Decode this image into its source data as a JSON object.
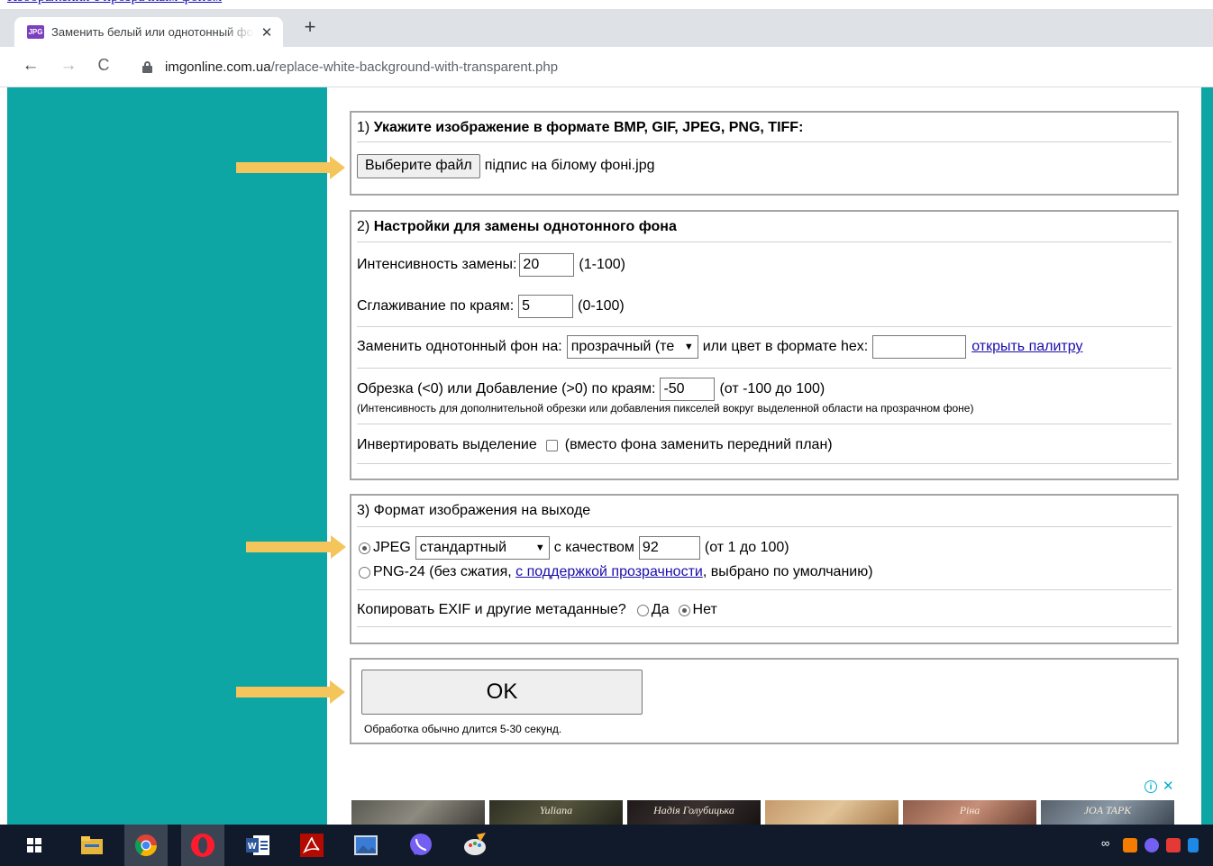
{
  "browser": {
    "tab_title": "Заменить белый или однотонный фон на прозрачный онлайн",
    "favicon_text": "JPG",
    "url_host": "imgonline.com.ua",
    "url_path": "/replace-white-background-with-transparent.php"
  },
  "section1": {
    "num": "1)",
    "title": "Укажите изображение в формате BMP, GIF, JPEG, PNG, TIFF:",
    "choose_file_label": "Выберите файл",
    "file_name": "підпис на білому фоні.jpg"
  },
  "section2": {
    "num": "2)",
    "title": "Настройки для замены однотонного фона",
    "intensity_label": "Интенсивность замены:",
    "intensity_value": "20",
    "intensity_range": "(1-100)",
    "smoothing_label": "Сглаживание по краям:",
    "smoothing_value": "5",
    "smoothing_range": "(0-100)",
    "replace_label": "Заменить однотонный фон на:",
    "replace_select": "прозрачный (те",
    "hex_label": "или цвет в формате hex:",
    "hex_value": "",
    "palette_link": "открыть палитру",
    "crop_label": "Обрезка (<0) или Добавление (>0) по краям:",
    "crop_value": "-50",
    "crop_range": "(от -100 до 100)",
    "crop_note": "(Интенсивность для дополнительной обрезки или добавления пикселей вокруг выделенной области на прозрачном фоне)",
    "invert_label": "Инвертировать выделение",
    "invert_note": "(вместо фона заменить передний план)"
  },
  "section3": {
    "title": "3) Формат изображения на выходе",
    "jpeg_label": "JPEG",
    "jpeg_select": "стандартный",
    "quality_label": "с качеством",
    "quality_value": "92",
    "quality_range": "(от 1 до 100)",
    "png_label": "PNG-24 (без сжатия,",
    "png_link": "с поддержкой прозрачности",
    "png_suffix": ", выбрано по умолчанию)",
    "exif_label": "Копировать EXIF и другие метаданные?",
    "exif_yes": "Да",
    "exif_no": "Нет"
  },
  "submit": {
    "ok_label": "OK",
    "note": "Обработка обычно длится 5-30 секунд."
  },
  "ads": {
    "thumbs": [
      "",
      "Yuliana",
      "Надія Голубицька",
      "",
      "Ріна",
      "JOA TAPK"
    ]
  },
  "colors": {
    "teal": "#0ea5a5",
    "arrow": "#f3c55a",
    "link": "#1a0dab",
    "taskbar": "#101a2a"
  },
  "taskbar": {
    "icons": [
      "windows-start-icon",
      "file-explorer-icon",
      "chrome-icon",
      "opera-icon",
      "word-icon",
      "acrobat-icon",
      "photos-icon",
      "viber-icon",
      "paint-icon"
    ]
  }
}
